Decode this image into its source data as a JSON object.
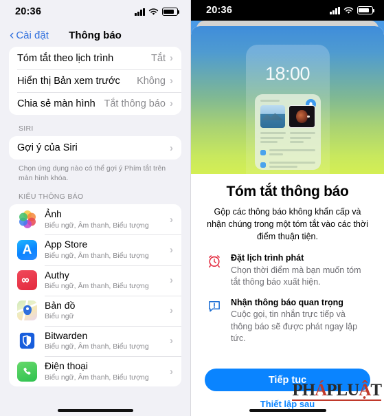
{
  "left": {
    "status": {
      "time": "20:36",
      "signal_icon": "cellular-bars-icon",
      "wifi_icon": "wifi-icon",
      "battery_icon": "battery-icon"
    },
    "nav": {
      "back_label": "Cài đặt",
      "title": "Thông báo",
      "back_icon": "chevron-left-icon"
    },
    "top_rows": [
      {
        "label": "Tóm tắt theo lịch trình",
        "value": "Tắt"
      },
      {
        "label": "Hiển thị Bản xem trước",
        "value": "Không"
      },
      {
        "label": "Chia sẻ màn hình",
        "value": "Tắt thông báo"
      }
    ],
    "siri": {
      "header": "SIRI",
      "row": {
        "label": "Gợi ý của Siri",
        "value": ""
      },
      "footer": "Chọn ứng dụng nào có thể gợi ý Phím tắt trên màn hình khóa."
    },
    "apps": {
      "header": "KIỂU THÔNG BÁO",
      "items": [
        {
          "name": "Ảnh",
          "sub": "Biểu ngữ, Âm thanh, Biểu tượng",
          "icon": "photos-app-icon"
        },
        {
          "name": "App Store",
          "sub": "Biểu ngữ, Âm thanh, Biểu tượng",
          "icon": "app-store-icon"
        },
        {
          "name": "Authy",
          "sub": "Biểu ngữ, Âm thanh, Biểu tượng",
          "icon": "authy-app-icon"
        },
        {
          "name": "Bản đồ",
          "sub": "Biểu ngữ",
          "icon": "maps-app-icon"
        },
        {
          "name": "Bitwarden",
          "sub": "Biểu ngữ, Âm thanh, Biểu tượng",
          "icon": "bitwarden-app-icon"
        },
        {
          "name": "Điện thoại",
          "sub": "Biểu ngữ, Âm thanh, Biểu tượng",
          "icon": "phone-app-icon"
        }
      ]
    }
  },
  "right": {
    "status": {
      "time": "20:36",
      "signal_icon": "cellular-bars-icon",
      "wifi_icon": "wifi-icon",
      "battery_icon": "battery-icon"
    },
    "hero": {
      "device_time": "18:00",
      "bell_icon": "bell-icon"
    },
    "title": "Tóm tắt thông báo",
    "subtitle": "Gộp các thông báo không khẩn cấp và nhận chúng trong một tóm tắt vào các thời điểm thuận tiện.",
    "features": [
      {
        "icon": "alarm-clock-icon",
        "heading": "Đặt lịch trình phát",
        "body": "Chọn thời điểm mà bạn muốn tóm tắt thông báo xuất hiện."
      },
      {
        "icon": "message-alert-icon",
        "heading": "Nhận thông báo quan trọng",
        "body": "Cuộc gọi, tin nhắn trực tiếp và thông báo sẽ được phát ngay lập tức."
      }
    ],
    "cta_label": "Tiếp tục",
    "later_label": "Thiết lập sau",
    "watermark": {
      "part1": "PH",
      "part2": "Á",
      "part3": "PLU",
      "part4": "Ậ",
      "part5": "T",
      "full": "PHÁPLUẬT"
    }
  },
  "colors": {
    "accent": "#0a84ff",
    "nav_link": "#2f6fdd",
    "bg": "#f1f1f6",
    "secondary_text": "#8a8a8e",
    "red": "#e3293e",
    "watermark_red": "#c0392b"
  }
}
